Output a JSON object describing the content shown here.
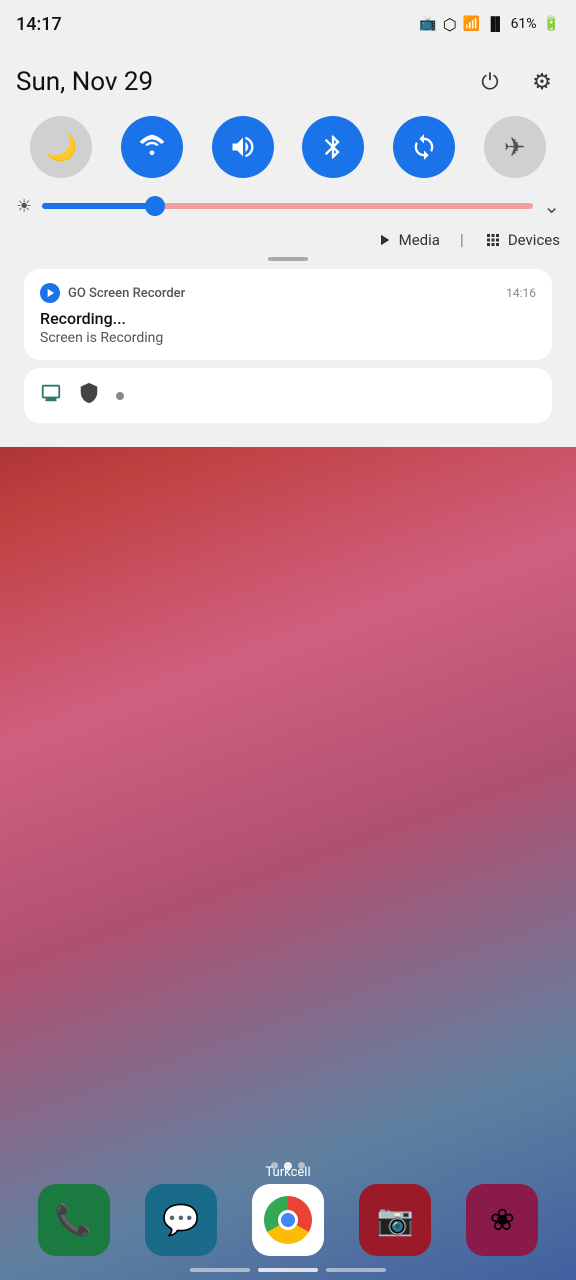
{
  "statusBar": {
    "time": "14:17",
    "battery": "61%",
    "batteryIcon": "🔋",
    "signalIcon": "📶",
    "bluetoothIcon": "🔵",
    "wifiIcon": "📡",
    "castIcon": "📺"
  },
  "dateRow": {
    "date": "Sun, Nov 29",
    "powerLabel": "power-icon",
    "settingsLabel": "settings-icon"
  },
  "toggles": [
    {
      "id": "do-not-disturb",
      "icon": "🌙",
      "active": false,
      "label": "Do Not Disturb"
    },
    {
      "id": "wifi",
      "icon": "📶",
      "active": true,
      "label": "Wi-Fi"
    },
    {
      "id": "sound",
      "icon": "🔊",
      "active": true,
      "label": "Sound"
    },
    {
      "id": "bluetooth",
      "icon": "🔵",
      "active": true,
      "label": "Bluetooth"
    },
    {
      "id": "sync",
      "icon": "🔄",
      "active": true,
      "label": "Sync"
    },
    {
      "id": "airplane",
      "icon": "✈",
      "active": false,
      "label": "Airplane Mode"
    }
  ],
  "brightness": {
    "value": 25,
    "iconLabel": "brightness-icon",
    "expandLabel": "expand-icon"
  },
  "mediaBar": {
    "mediaLabel": "Media",
    "divider": "|",
    "devicesLabel": "Devices"
  },
  "notification": {
    "appIcon": "▶",
    "appName": "GO Screen Recorder",
    "time": "14:16",
    "title": "Recording...",
    "body": "Screen is Recording"
  },
  "systemIconsRow": {
    "icons": [
      "monitor",
      "shield",
      "dot"
    ]
  },
  "dock": {
    "apps": [
      {
        "id": "phone",
        "label": "",
        "color": "green"
      },
      {
        "id": "messages",
        "label": "",
        "color": "teal"
      },
      {
        "id": "chrome",
        "label": "",
        "color": "white-bg"
      },
      {
        "id": "camera",
        "label": "",
        "color": "dark-red"
      },
      {
        "id": "flower",
        "label": "",
        "color": "dark-pink"
      }
    ],
    "carrierLabel": "Turkcell"
  }
}
